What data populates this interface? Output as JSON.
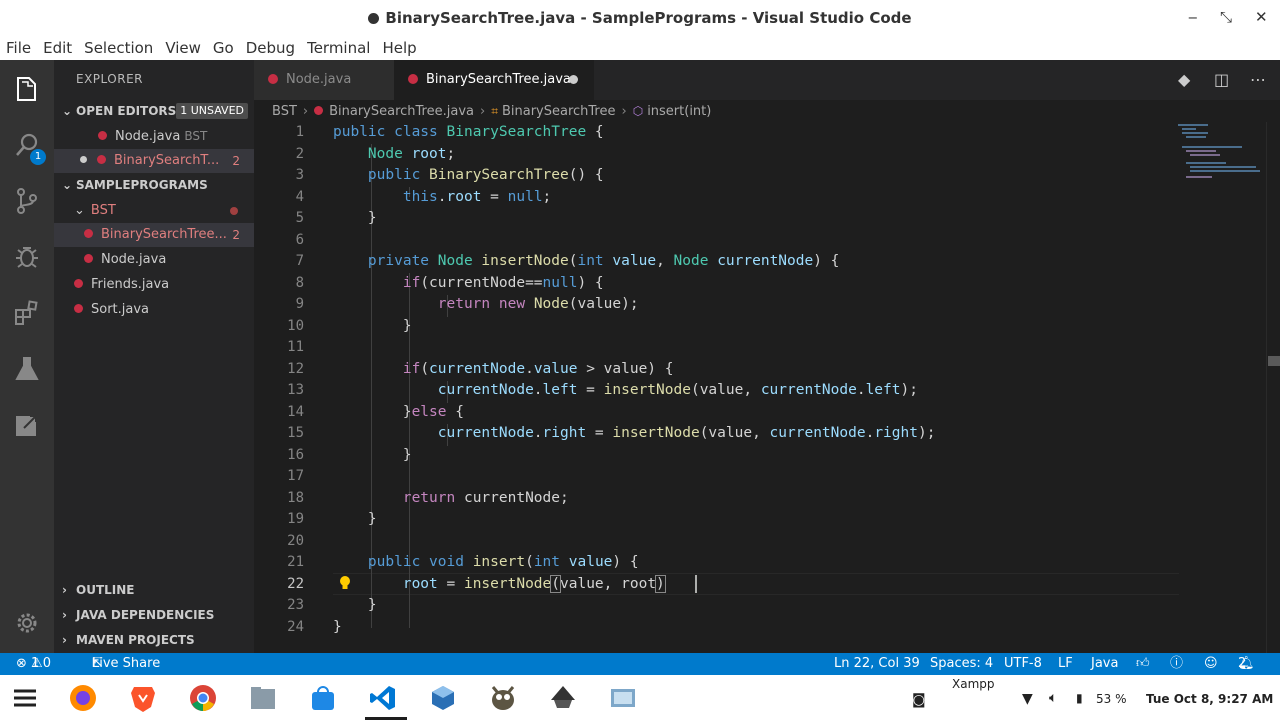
{
  "window": {
    "title": "BinarySearchTree.java - SamplePrograms - Visual Studio Code",
    "controls": {
      "minimize": "‒",
      "maximize": "⤡",
      "close": "✕"
    }
  },
  "menu": [
    "File",
    "Edit",
    "Selection",
    "View",
    "Go",
    "Debug",
    "Terminal",
    "Help"
  ],
  "activity_bar": {
    "items": [
      "files-icon",
      "search-icon",
      "source-control-icon",
      "debug-icon",
      "extensions-icon",
      "test-icon",
      "live-share-icon",
      "settings-gear-icon"
    ],
    "explorer_badge": "1"
  },
  "sidebar": {
    "title": "EXPLORER",
    "open_editors": {
      "label": "OPEN EDITORS",
      "badge": "1 UNSAVED",
      "items": [
        {
          "name": "Node.java",
          "folder": "BST"
        },
        {
          "name": "BinarySearchT...",
          "count": "2"
        }
      ]
    },
    "project": {
      "label": "SAMPLEPROGRAMS",
      "folder": "BST",
      "folder_files": [
        {
          "name": "BinarySearchTree...",
          "count": "2"
        },
        {
          "name": "Node.java"
        }
      ],
      "files": [
        "Friends.java",
        "Sort.java"
      ]
    },
    "bottom_sections": [
      "OUTLINE",
      "JAVA DEPENDENCIES",
      "MAVEN PROJECTS"
    ]
  },
  "tabs": [
    {
      "label": "Node.java",
      "active": false
    },
    {
      "label": "BinarySearchTree.java",
      "active": true,
      "modified": true
    }
  ],
  "breadcrumb": [
    "BST",
    "BinarySearchTree.java",
    "BinarySearchTree",
    "insert(int)"
  ],
  "editor": {
    "line_numbers": [
      "1",
      "2",
      "3",
      "4",
      "5",
      "6",
      "7",
      "8",
      "9",
      "10",
      "11",
      "12",
      "13",
      "14",
      "15",
      "16",
      "17",
      "18",
      "19",
      "20",
      "21",
      "22",
      "23",
      "24"
    ],
    "current_line": "22"
  },
  "statusbar": {
    "errors": "1",
    "warnings": "0",
    "live_share": "Live Share",
    "position": "Ln 22, Col 39",
    "spaces": "Spaces: 4",
    "encoding": "UTF-8",
    "eol": "LF",
    "language": "Java",
    "notifications": "2"
  },
  "taskbar": {
    "apps": [
      "menu-icon",
      "firefox-icon",
      "brave-icon",
      "chrome-icon",
      "files-icon",
      "store-icon",
      "vscode-icon",
      "virtualbox-icon",
      "gimp-icon",
      "inkscape-icon",
      "screen-icon"
    ],
    "tray_label": "Xampp",
    "battery": "53 %",
    "clock": "Tue Oct  8,  9:27 AM"
  },
  "colors": {
    "accent": "#007acc",
    "java_file": "#c72e44",
    "modified_text": "#e07f7f"
  }
}
